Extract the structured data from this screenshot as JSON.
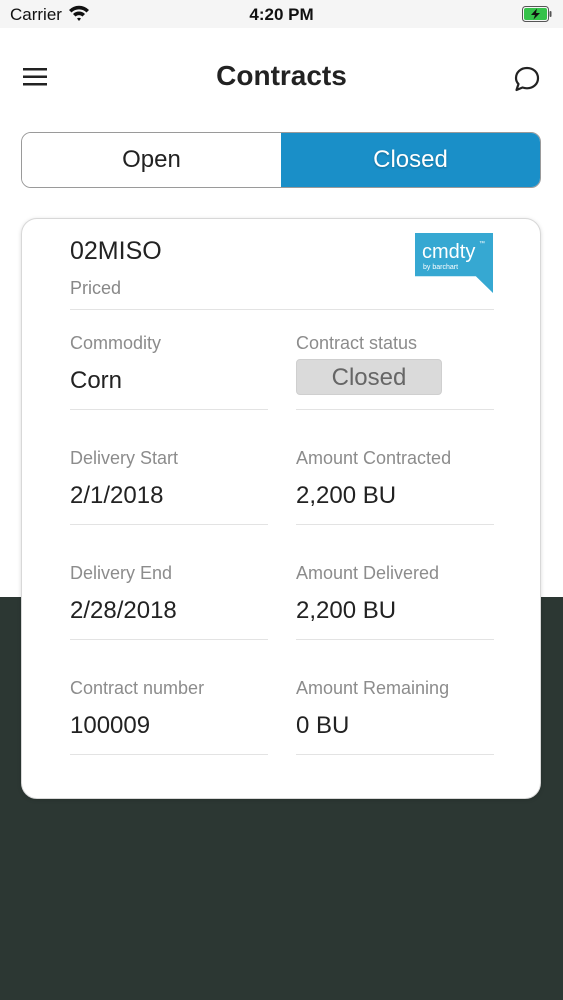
{
  "status_bar": {
    "carrier": "Carrier",
    "time": "4:20 PM"
  },
  "header": {
    "title": "Contracts"
  },
  "tabs": [
    {
      "label": "Open",
      "selected": false
    },
    {
      "label": "Closed",
      "selected": true
    }
  ],
  "colors": {
    "accent": "#1a8fc8",
    "logo": "#36a8d2",
    "bottom_background": "#2c3733"
  },
  "contract": {
    "id": "02MISO",
    "type": "Priced",
    "logo": {
      "text": "cmdty",
      "tm": "™",
      "subtext": "by barchart"
    },
    "fields": {
      "commodity": {
        "label": "Commodity",
        "value": "Corn"
      },
      "status": {
        "label": "Contract status",
        "value": "Closed"
      },
      "delivery_start": {
        "label": "Delivery Start",
        "value": "2/1/2018"
      },
      "amount_contracted": {
        "label": "Amount Contracted",
        "value": "2,200 BU"
      },
      "delivery_end": {
        "label": "Delivery End",
        "value": "2/28/2018"
      },
      "amount_delivered": {
        "label": "Amount Delivered",
        "value": "2,200 BU"
      },
      "contract_number": {
        "label": "Contract number",
        "value": "100009"
      },
      "amount_remaining": {
        "label": "Amount Remaining",
        "value": "0 BU"
      }
    }
  }
}
